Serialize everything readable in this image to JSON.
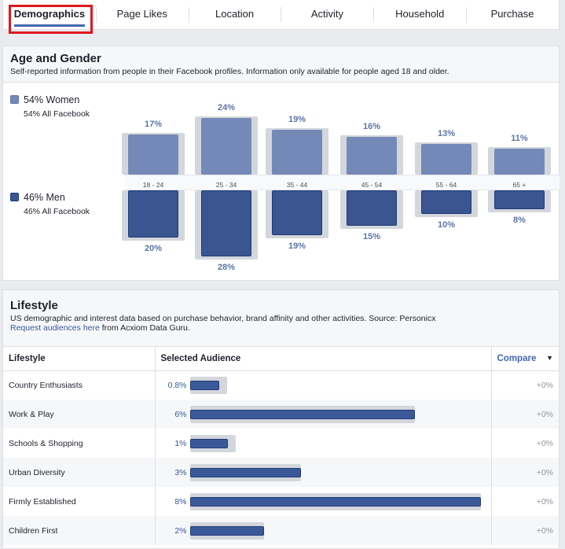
{
  "tabs": [
    {
      "label": "Demographics",
      "active": true
    },
    {
      "label": "Page Likes"
    },
    {
      "label": "Location"
    },
    {
      "label": "Activity"
    },
    {
      "label": "Household"
    },
    {
      "label": "Purchase"
    }
  ],
  "age_gender": {
    "title": "Age and Gender",
    "description": "Self-reported information from people in their Facebook profiles. Information only available for people aged 18 and older.",
    "women": {
      "label": "54% Women",
      "sub": "54% All Facebook",
      "color": "#7489b7"
    },
    "men": {
      "label": "46% Men",
      "sub": "46% All Facebook",
      "color": "#3b5590"
    },
    "chart_data": {
      "type": "bar",
      "categories": [
        "18 - 24",
        "25 - 34",
        "35 - 44",
        "45 - 54",
        "55 - 64",
        "65 +"
      ],
      "series": [
        {
          "name": "Women",
          "values": [
            17,
            24,
            19,
            16,
            13,
            11
          ],
          "labels": [
            "17%",
            "24%",
            "19%",
            "16%",
            "13%",
            "11%"
          ]
        },
        {
          "name": "Men",
          "values": [
            20,
            28,
            19,
            15,
            10,
            8
          ],
          "labels": [
            "20%",
            "28%",
            "19%",
            "15%",
            "10%",
            "8%"
          ]
        }
      ]
    }
  },
  "lifestyle": {
    "title": "Lifestyle",
    "description": "US demographic and interest data based on purchase behavior, brand affinity and other activities. Source: Personicx",
    "link": "Request audiences here",
    "link_suffix": " from Acxiom Data Guru.",
    "columns": [
      "Lifestyle",
      "Selected Audience",
      "Compare"
    ],
    "rows": [
      {
        "name": "Country Enthusiasts",
        "value": "0.8%",
        "pct": 0.8,
        "compare": "+0%"
      },
      {
        "name": "Work & Play",
        "value": "6%",
        "pct": 6.2,
        "compare": "+0%"
      },
      {
        "name": "Schools & Shopping",
        "value": "1%",
        "pct": 1.05,
        "compare": "+0%"
      },
      {
        "name": "Urban Diversity",
        "value": "3%",
        "pct": 3.05,
        "compare": "+0%"
      },
      {
        "name": "Firmly Established",
        "value": "8%",
        "pct": 8,
        "compare": "+0%"
      },
      {
        "name": "Children First",
        "value": "2%",
        "pct": 2.05,
        "compare": "+0%"
      }
    ]
  }
}
